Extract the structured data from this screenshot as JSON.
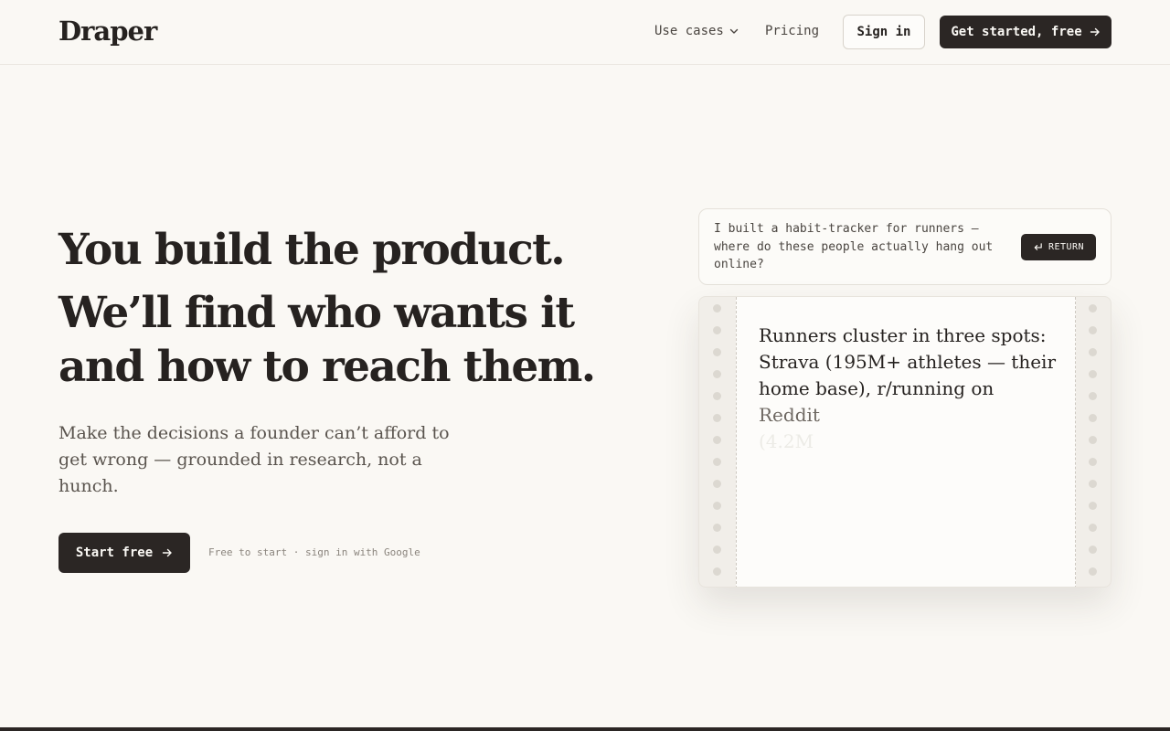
{
  "header": {
    "logo": "Draper",
    "nav": {
      "use_cases": "Use cases",
      "pricing": "Pricing"
    },
    "sign_in": "Sign in",
    "get_started": "Get started, free"
  },
  "hero": {
    "headline_line1": "You build the product.",
    "headline_line2": "We’ll find who wants it and how to reach them.",
    "subcopy": "Make the decisions a founder can’t afford to get wrong — grounded in research, not a hunch.",
    "cta": "Start free",
    "cta_note": "Free to start · sign in with Google"
  },
  "demo": {
    "prompt": "I built a habit-tracker for runners — where do these people actually hang out online?",
    "return_label": "RETURN",
    "answer_main": "Runners cluster in three spots: Strava (195M+ athletes — their home base), r/running on ",
    "answer_fading": "Reddit",
    "answer_faded": "(4.2M"
  },
  "icons": {
    "chevron": "chevron-down-icon",
    "arrow": "arrow-right-icon",
    "return": "return-icon"
  },
  "colors": {
    "background": "#faf8f4",
    "ink": "#262220",
    "button_dark": "#2b2624",
    "muted": "#5a544e"
  }
}
